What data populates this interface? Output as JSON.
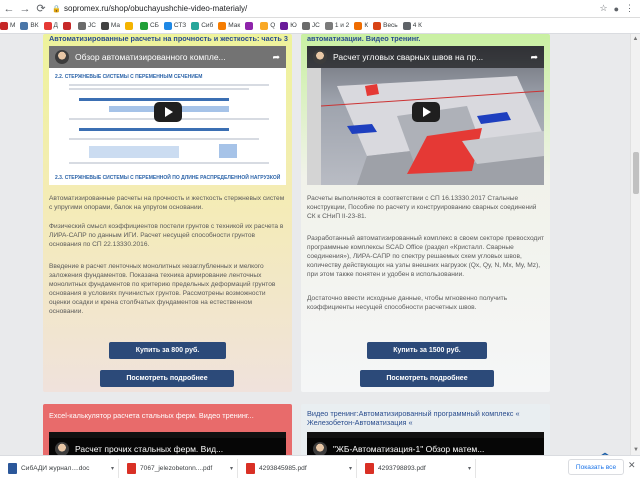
{
  "browser": {
    "url": "sopromex.ru/shop/obuchayushchie-video-materialy/",
    "bookmarks": [
      {
        "label": "М",
        "color": "#c62828"
      },
      {
        "label": "ВК",
        "color": "#4a76a8"
      },
      {
        "label": "Д",
        "color": "#e53935"
      },
      {
        "label": "",
        "color": "#c62828"
      },
      {
        "label": "JC",
        "color": "#6b6b6b"
      },
      {
        "label": "Ma",
        "color": "#424242"
      },
      {
        "label": "",
        "color": "#f4b400"
      },
      {
        "label": "СБ",
        "color": "#21a038"
      },
      {
        "label": "СТЗ",
        "color": "#1e88e5"
      },
      {
        "label": "Сиб",
        "color": "#26a69a"
      },
      {
        "label": "Мак",
        "color": "#f57c00"
      },
      {
        "label": "",
        "color": "#8e24aa"
      },
      {
        "label": "Q",
        "color": "#f9a825"
      },
      {
        "label": "Ю",
        "color": "#6a1b9a"
      },
      {
        "label": "JC",
        "color": "#6b6b6b"
      },
      {
        "label": "1 и 2",
        "color": "#7b7b7b"
      },
      {
        "label": "К",
        "color": "#ef6c00"
      },
      {
        "label": "Весь",
        "color": "#d84315"
      },
      {
        "label": "4 К",
        "color": "#5f6368"
      }
    ]
  },
  "cards": [
    {
      "title": "Автоматизированные расчеты на прочность и жесткость: часть 3",
      "video_title": "Обзор автоматизированного компле...",
      "doc_headings": [
        "2.2. СТЕРЖНЕВЫЕ СИСТЕМЫ С ПЕРЕМЕННЫМ СЕЧЕНИЕМ",
        "2.3. СТЕРЖНЕВЫЕ СИСТЕМЫ С ПЕРЕМЕННОЙ ПО ДЛИНЕ РАСПРЕДЕЛЕННОЙ НАГРУЗКОЙ"
      ],
      "paragraphs": [
        "Автоматизированные расчеты на прочность и жесткость стержневых систем с упругими опорами, балок на упругом основании.",
        "Физический смысл коэффициентов постели грунтов с техникой их расчета в ЛИРА-САПР по данным ИГИ. Расчет несущей способности грунтов основания по СП 22.13330.2016.",
        "Введение в расчет ленточных монолитных незаглубленных и мелкого заложения фундаментов. Показана техника армирование ленточных монолитных фундаментов по критерию предельных деформаций грунтов основания в условиях пучинистых грунтов. Рассмотрены возможности оценки осадки и крена столбчатых фундаментов на естественном основании."
      ],
      "buy_label": "Купить за 800 руб.",
      "more_label": "Посмотреть подробнее"
    },
    {
      "title": "автоматизации. Видео тренинг.",
      "video_title": "Расчет угловых сварных швов на пр...",
      "paragraphs": [
        "Расчеты выполняются в соответствии с СП 16.13330.2017 Стальные конструкции, Пособие по расчету и конструированию сварных соединений СК к СНиП II-23-81.",
        "Разработанный автоматизированный комплекс в своем секторе превосходит программные комплексы SCAD Office (раздел «Кристалл. Сварные соединения»), ЛИРА-САПР по спектру решаемых схем угловых швов, количеству действующих на узлы внешних нагрузок (Qx, Qy, N, Mx, My, Mz), при этом также понятен и удобен в использовании.",
        "Достаточно ввести исходные данные, чтобы мгновенно получить коэффициенты несущей способности расчетных швов."
      ],
      "buy_label": "Купить за 1500 руб.",
      "more_label": "Посмотреть подробнее"
    },
    {
      "title": "Excel-калькулятор расчета стальных ферм. Видео тренинг...",
      "video_title": "Расчет прочих стальных ферм. Вид..."
    },
    {
      "title": "Видео тренинг:Автоматизированный программный комплекс « Железобетон-Автоматизация «",
      "video_title": "\"ЖБ-Автоматизация-1\" Обзор матем..."
    }
  ],
  "downloads": [
    {
      "name": "СибАДИ журнал....doc",
      "color": "#2b579a"
    },
    {
      "name": "7067_jelezobetonn....pdf",
      "color": "#d93025"
    },
    {
      "name": "4293845985.pdf",
      "color": "#d93025"
    },
    {
      "name": "4293798893.pdf",
      "color": "#d93025"
    }
  ],
  "show_all_label": "Показать все"
}
